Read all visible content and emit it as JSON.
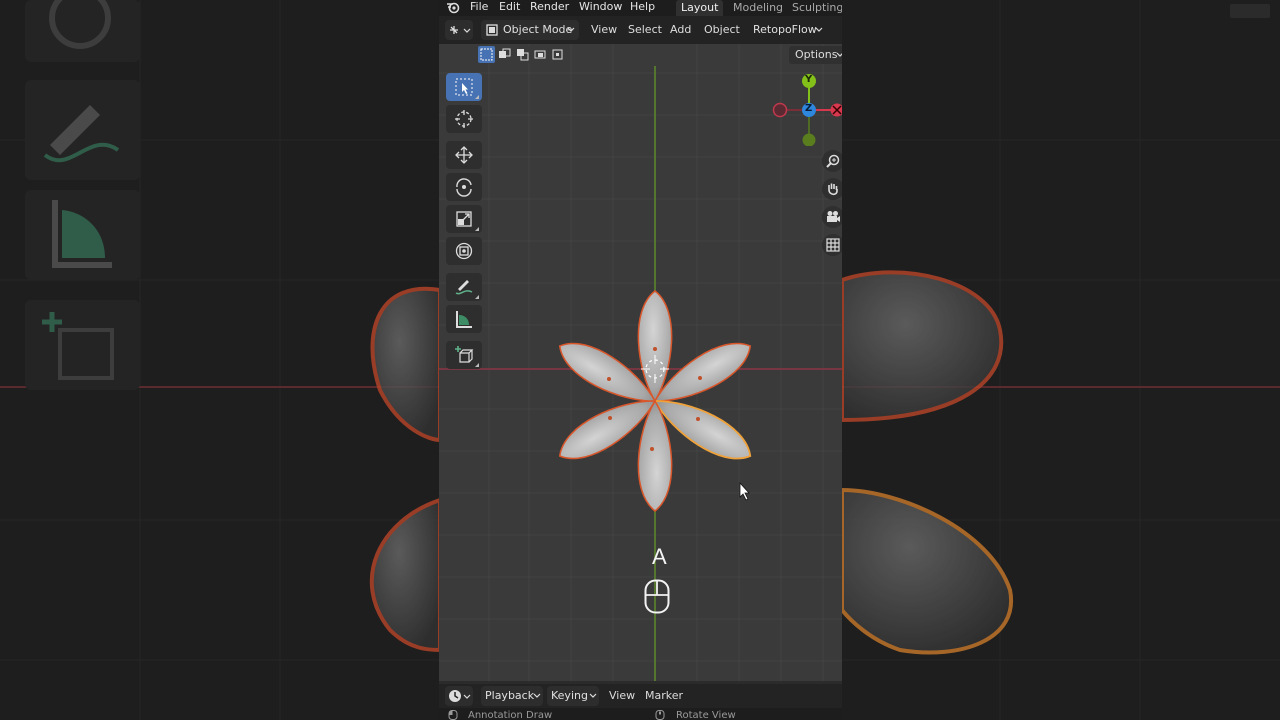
{
  "menu": {
    "file": "File",
    "edit": "Edit",
    "render": "Render",
    "window": "Window",
    "help": "Help"
  },
  "workspaces": {
    "layout": "Layout",
    "modeling": "Modeling",
    "sculpting": "Sculpting"
  },
  "header": {
    "mode": "Object Mode",
    "view": "View",
    "select": "Select",
    "add": "Add",
    "object": "Object",
    "addon": "RetopoFlow",
    "options": "Options"
  },
  "gizmo": {
    "y": "Y",
    "z": "Z"
  },
  "overlay": {
    "key": "A"
  },
  "timeline": {
    "playback": "Playback",
    "keying": "Keying",
    "view": "View",
    "marker": "Marker"
  },
  "status": {
    "left": "Annotation Draw",
    "right": "Rotate View"
  },
  "colors": {
    "active_tool": "#4772b3",
    "axis_x": "#d8384e",
    "axis_y": "#84c01a",
    "axis_z": "#2f86dd",
    "selection_outline": "#e0622c",
    "active_outline": "#f0a23a"
  }
}
